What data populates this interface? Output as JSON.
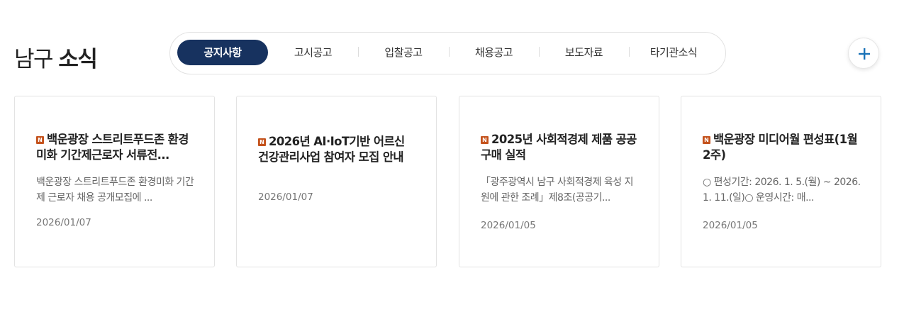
{
  "header": {
    "title_light": "남구 ",
    "title_bold": "소식"
  },
  "tabs": [
    {
      "label": "공지사항",
      "active": true
    },
    {
      "label": "고시공고",
      "active": false
    },
    {
      "label": "입찰공고",
      "active": false
    },
    {
      "label": "채용공고",
      "active": false
    },
    {
      "label": "보도자료",
      "active": false
    },
    {
      "label": "타기관소식",
      "active": false
    }
  ],
  "more_button": {
    "icon": "plus-icon",
    "color": "#1a73b8"
  },
  "badge_letter": "N",
  "colors": {
    "active_tab": "#17325f",
    "badge": "#c4521c",
    "plus": "#1a73b8"
  },
  "cards": [
    {
      "title": "백운광장 스트리트푸드존 환경미화 기간제근로자 서류전...",
      "description": "백운광장 스트리트푸드존 환경미화 기간제 근로자 채용 공개모집에 ...",
      "date": "2026/01/07"
    },
    {
      "title": "2026년 AI·IoT기반 어르신 건강관리사업 참여자 모집 안내",
      "description": "",
      "date": "2026/01/07"
    },
    {
      "title": "2025년 사회적경제 제품 공공구매 실적",
      "description": "「광주광역시 남구 사회적경제 육성 지원에 관한 조례」제8조(공공기...",
      "date": "2026/01/05"
    },
    {
      "title": "백운광장 미디어월 편성표(1월 2주)",
      "description": "○ 편성기간: 2026. 1. 5.(월) ~ 2026. 1. 11.(일)○ 운영시간: 매...",
      "date": "2026/01/05"
    }
  ]
}
